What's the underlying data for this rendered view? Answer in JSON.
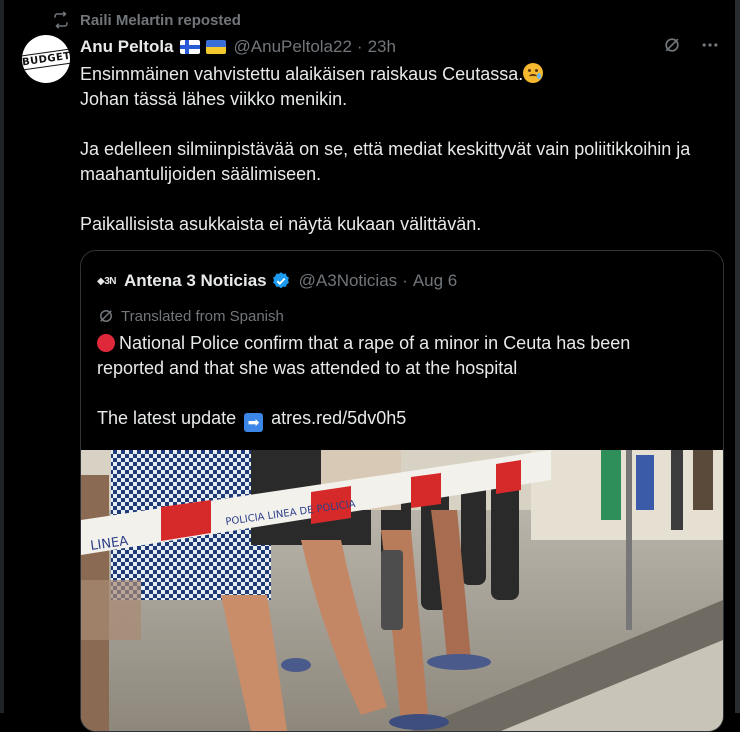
{
  "repost": {
    "label": "Raili Melartin reposted"
  },
  "author": {
    "avatar_text": "BUDGET",
    "name": "Anu Peltola",
    "handle": "@AnuPeltola22",
    "separator": "·",
    "time": "23h"
  },
  "tweet": {
    "line1": "Ensimmäinen vahvistettu alaikäisen raiskaus Ceutassa.",
    "line2": "Johan tässä lähes viikko menikin.",
    "para2": "Ja edelleen silmiinpistävää on se, että mediat keskittyvät vain poliitikkoihin ja maahantulijoiden säälimiseen.",
    "para3": "Paikallisista asukkaista ei näytä kukaan välittävän."
  },
  "quote": {
    "logo_text": "◆3N",
    "name": "Antena 3 Noticias",
    "handle": "@A3Noticias",
    "separator": "·",
    "date": "Aug 6",
    "translated_label": "Translated from Spanish",
    "text1": "National Police confirm that a rape of a minor in Ceuta has been reported and that she was attended to at the hospital",
    "text2_prefix": "The latest update",
    "link": "atres.red/5dv0h5",
    "tape_text": "POLICIA · LINEA DE POLICIA"
  },
  "icons": {
    "repost": "repost-icon",
    "grok": "grok-icon",
    "more": "more-icon",
    "verified": "verified-badge-icon",
    "translate": "translate-icon"
  },
  "colors": {
    "background": "#000000",
    "text": "#e7e9ea",
    "muted": "#71767b",
    "border": "#2f3336",
    "verified": "#1d9bf0"
  }
}
